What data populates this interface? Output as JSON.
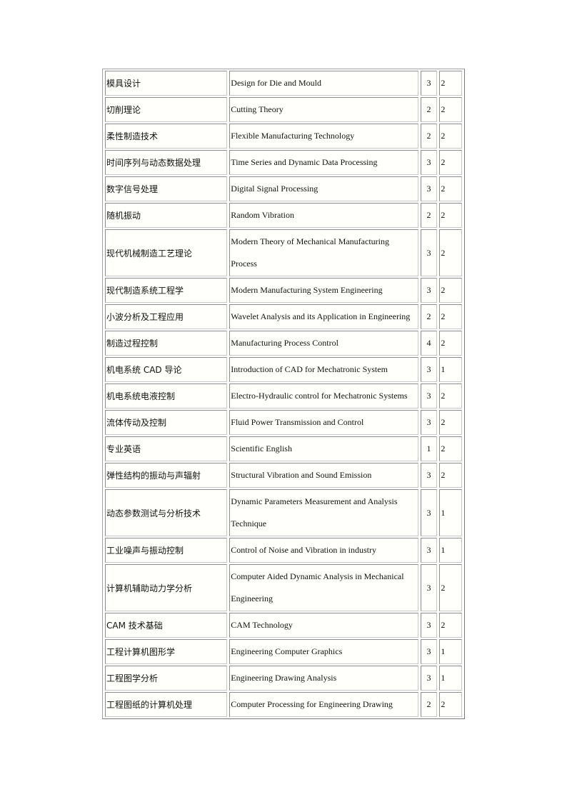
{
  "courses": [
    {
      "cn": "模具设计",
      "en": "Design for Die and Mould",
      "a": "3",
      "b": "2"
    },
    {
      "cn": "切削理论",
      "en": "Cutting  Theory",
      "a": "2",
      "b": "2"
    },
    {
      "cn": "柔性制造技术",
      "en": "Flexible Manufacturing  Technology",
      "a": "2",
      "b": "2"
    },
    {
      "cn": "时间序列与动态数据处理",
      "en": "Time Series and Dynamic Data Processing",
      "a": "3",
      "b": "2"
    },
    {
      "cn": "数字信号处理",
      "en": "Digital Signal Processing",
      "a": "3",
      "b": "2"
    },
    {
      "cn": "随机振动",
      "en": "Random Vibration",
      "a": "2",
      "b": "2"
    },
    {
      "cn": "现代机械制造工艺理论",
      "en": "Modern Theory of Mechanical  Manufacturing Process",
      "a": "3",
      "b": "2",
      "tall": true
    },
    {
      "cn": "现代制造系统工程学",
      "en": "Modern Manufacturing  System Engineering",
      "a": "3",
      "b": "2"
    },
    {
      "cn": "小波分析及工程应用",
      "en": "Wavelet Analysis and its Application in Engineering",
      "a": "2",
      "b": "2"
    },
    {
      "cn": "制造过程控制",
      "en": "Manufacturing Process Control",
      "a": "4",
      "b": "2"
    },
    {
      "cn": "机电系统 CAD 导论",
      "en": "Introduction of CAD for Mechatronic System",
      "a": "3",
      "b": "1"
    },
    {
      "cn": "机电系统电液控制",
      "en": "Electro-Hydraulic  control for Mechatronic Systems",
      "a": "3",
      "b": "2"
    },
    {
      "cn": "流体传动及控制",
      "en": "Fluid Power Transmission and Control",
      "a": "3",
      "b": "2"
    },
    {
      "cn": "专业英语",
      "en": "Scientific English",
      "a": "1",
      "b": "2"
    },
    {
      "cn": "弹性结构的振动与声辐射",
      "en": "Structural Vibration and Sound Emission",
      "a": "3",
      "b": "2"
    },
    {
      "cn": "动态参数测试与分析技术",
      "en": "Dynamic Parameters Measurement  and Analysis Technique",
      "a": "3",
      "b": "1",
      "tall": true
    },
    {
      "cn": "工业噪声与振动控制",
      "en": "Control of Noise and Vibration in industry",
      "a": "3",
      "b": "1"
    },
    {
      "cn": "计算机辅助动力学分析",
      "en": "Computer  Aided Dynamic Analysis in Mechanical Engineering",
      "a": "3",
      "b": "2",
      "tall": true
    },
    {
      "cn": "CAM 技术基础",
      "en": "CAM Technology",
      "a": "3",
      "b": "2"
    },
    {
      "cn": "工程计算机图形学",
      "en": "Engineering  Computer Graphics",
      "a": "3",
      "b": "1"
    },
    {
      "cn": "工程图学分析",
      "en": "Engineering  Drawing Analysis",
      "a": "3",
      "b": "1"
    },
    {
      "cn": "工程图纸的计算机处理",
      "en": "Computer Processing for Engineering  Drawing",
      "a": "2",
      "b": "2"
    }
  ]
}
